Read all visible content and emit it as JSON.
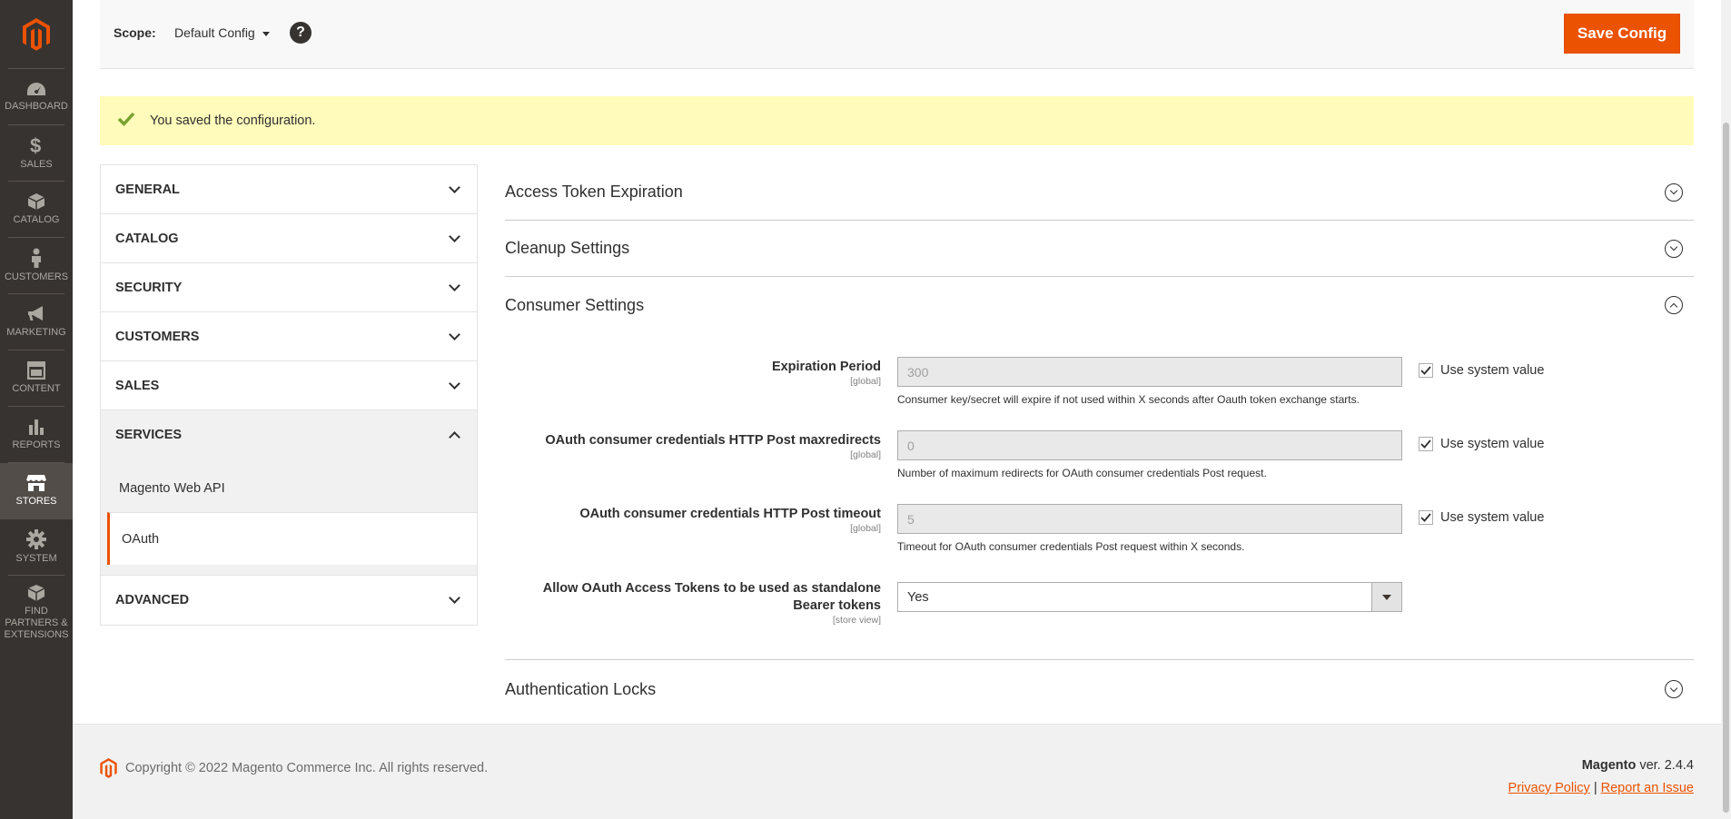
{
  "nav": {
    "items": [
      {
        "label": "DASHBOARD",
        "icon": "dashboard-icon"
      },
      {
        "label": "SALES",
        "icon": "dollar-icon"
      },
      {
        "label": "CATALOG",
        "icon": "box-icon"
      },
      {
        "label": "CUSTOMERS",
        "icon": "person-icon"
      },
      {
        "label": "MARKETING",
        "icon": "megaphone-icon"
      },
      {
        "label": "CONTENT",
        "icon": "layout-icon"
      },
      {
        "label": "REPORTS",
        "icon": "bar-chart-icon"
      },
      {
        "label": "STORES",
        "icon": "storefront-icon"
      },
      {
        "label": "SYSTEM",
        "icon": "gear-icon"
      },
      {
        "label": "FIND PARTNERS & EXTENSIONS",
        "icon": "cubes-icon"
      }
    ]
  },
  "header": {
    "scope_label": "Scope:",
    "scope_value": "Default Config",
    "help": "?",
    "save_label": "Save Config"
  },
  "message": "You saved the configuration.",
  "tabs": {
    "general": "GENERAL",
    "catalog": "CATALOG",
    "security": "SECURITY",
    "customers": "CUSTOMERS",
    "sales": "SALES",
    "services": "SERVICES",
    "services_items": [
      "Magento Web API",
      "OAuth"
    ],
    "advanced": "ADVANCED"
  },
  "sections": {
    "access_token": "Access Token Expiration",
    "cleanup": "Cleanup Settings",
    "consumer": "Consumer Settings",
    "auth_locks": "Authentication Locks"
  },
  "fields": {
    "expiration": {
      "label": "Expiration Period",
      "scope": "[global]",
      "value": "300",
      "note": "Consumer key/secret will expire if not used within X seconds after Oauth token exchange starts.",
      "system": "Use system value"
    },
    "maxredirects": {
      "label": "OAuth consumer credentials HTTP Post maxredirects",
      "scope": "[global]",
      "value": "0",
      "note": "Number of maximum redirects for OAuth consumer credentials Post request.",
      "system": "Use system value"
    },
    "timeout": {
      "label": "OAuth consumer credentials HTTP Post timeout",
      "scope": "[global]",
      "value": "5",
      "note": "Timeout for OAuth consumer credentials Post request within X seconds.",
      "system": "Use system value"
    },
    "bearer": {
      "label": "Allow OAuth Access Tokens to be used as standalone Bearer tokens",
      "scope": "[store view]",
      "value": "Yes"
    }
  },
  "footer": {
    "copyright": "Copyright © 2022 Magento Commerce Inc. All rights reserved.",
    "brand": "Magento",
    "version": "ver. 2.4.4",
    "privacy": "Privacy Policy",
    "separator": "|",
    "report": "Report an Issue"
  },
  "colors": {
    "accent": "#eb5202",
    "nav_bg": "#373330",
    "message_bg": "#fffbbb",
    "success": "#79a22e"
  }
}
